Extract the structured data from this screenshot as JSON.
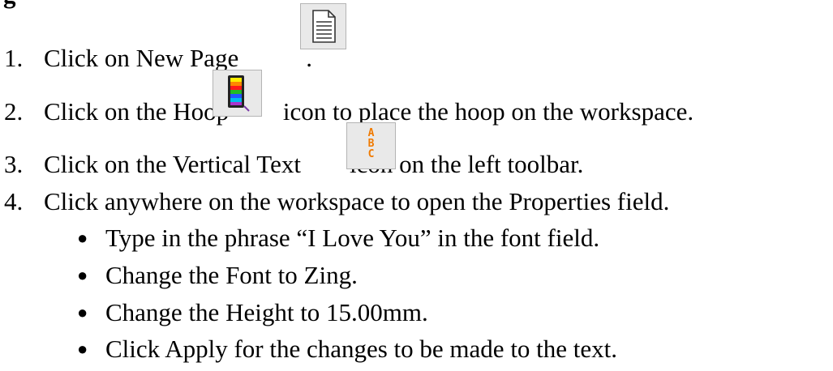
{
  "heading_fragment": "g",
  "steps": [
    {
      "number": "1.",
      "before": "Click on New Page",
      "after": ".",
      "icon": "new-page-icon"
    },
    {
      "number": "2.",
      "before": "Click on the Hoop",
      "after": " icon to place the hoop on the workspace.",
      "icon": "hoop-icon"
    },
    {
      "number": "3.",
      "before": "Click on the Vertical Text",
      "after": "icon on the left toolbar.",
      "icon": "vertical-text-icon"
    },
    {
      "number": "4.",
      "text": "Click anywhere on the workspace to open the Properties field."
    }
  ],
  "bullets": [
    "Type in the phrase “I Love You” in the font field.",
    "Change the Font to Zing.",
    "Change the Height to 15.00mm.",
    "Click Apply for the changes to be made to the text."
  ],
  "icon_labels": {
    "vertical_text": "A\nB\nC"
  },
  "colors": {
    "icon_background": "#e9e9e9",
    "vertical_text_letters": "#f07a00"
  }
}
